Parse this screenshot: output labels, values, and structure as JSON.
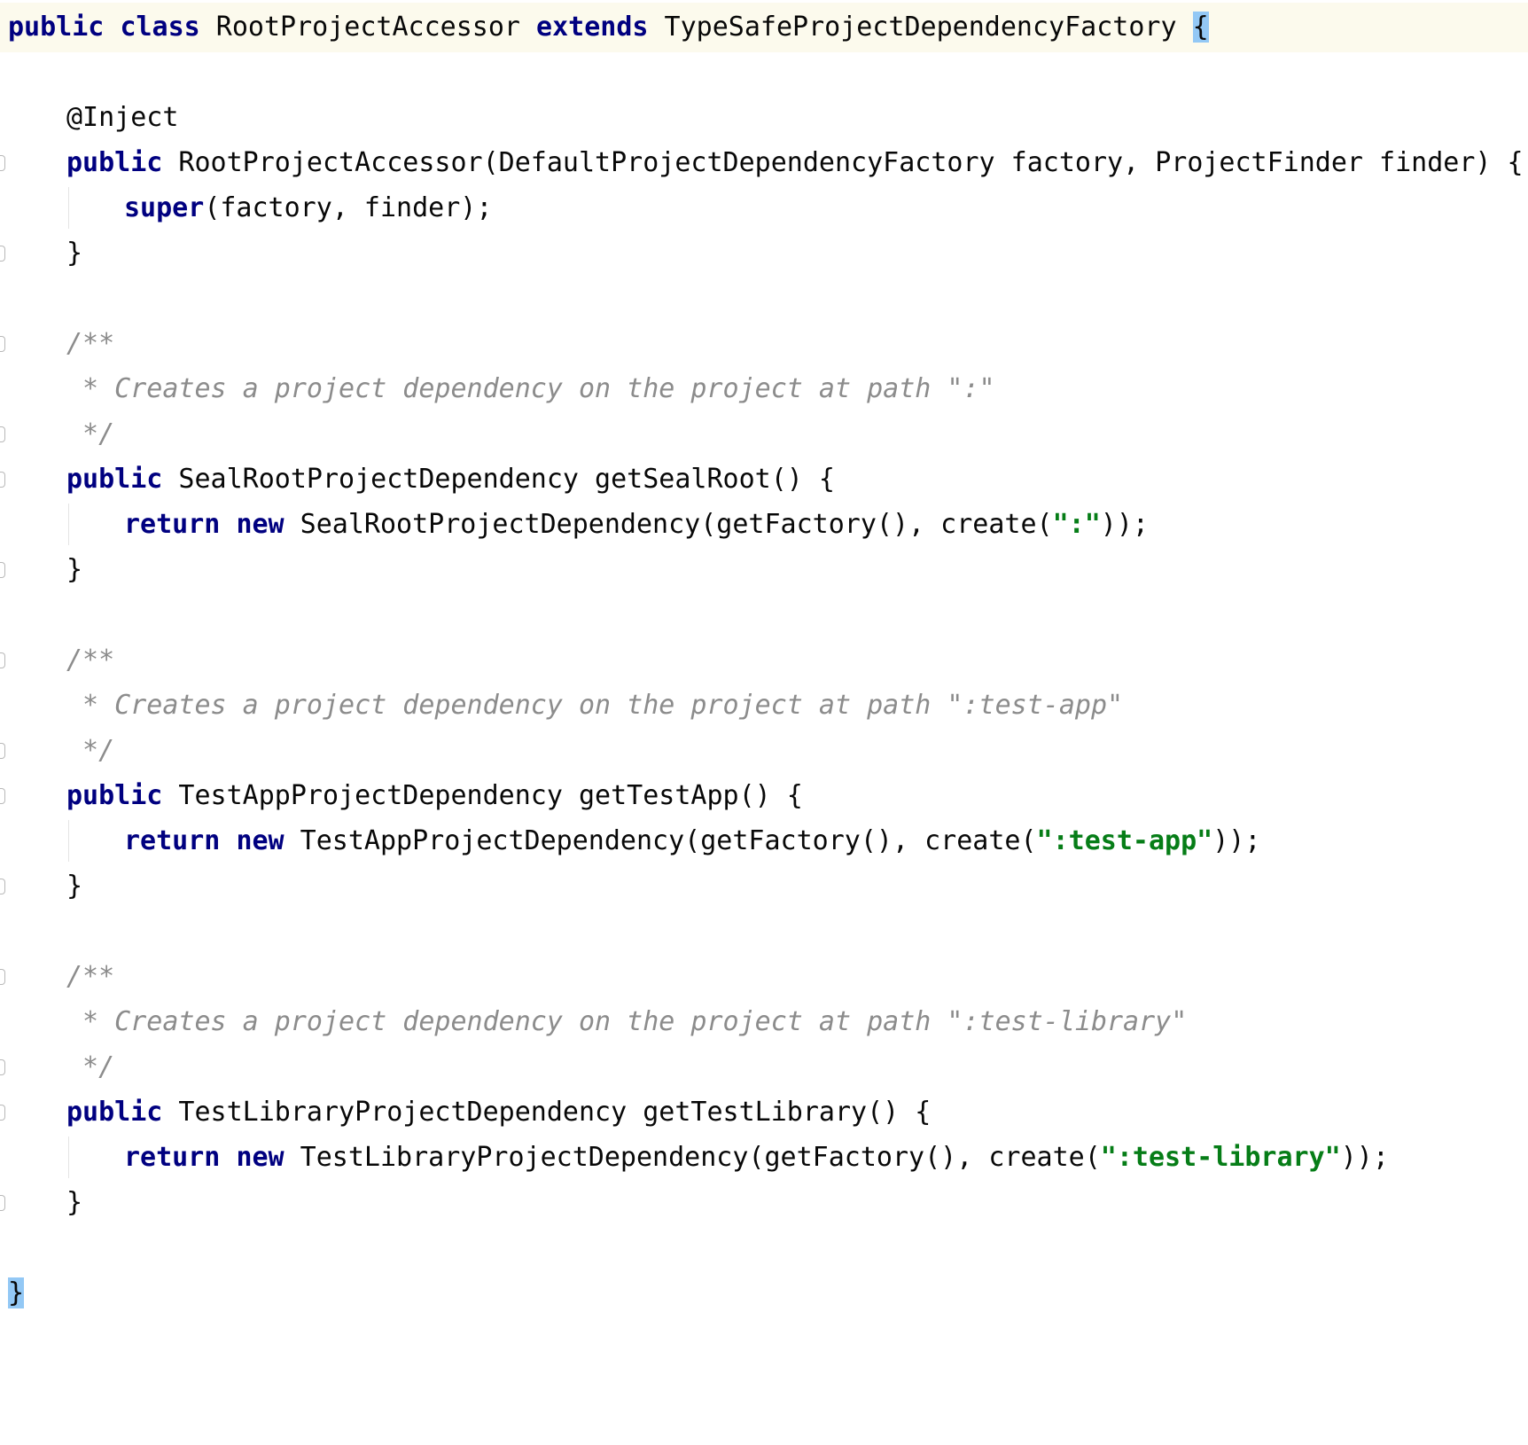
{
  "editor": {
    "lines": [
      {
        "segments": [
          {
            "t": "public",
            "c": "kw-nav"
          },
          {
            "t": " "
          },
          {
            "t": "class",
            "c": "kw-nav"
          },
          {
            "t": " RootProjectAccessor "
          },
          {
            "t": "extends",
            "c": "kw-nav"
          },
          {
            "t": " TypeSafeProjectDependencyFactory "
          },
          {
            "t": "{",
            "c": "brace-match"
          }
        ],
        "current": true,
        "indent": 0
      },
      {
        "segments": [],
        "indent": 0
      },
      {
        "segments": [
          {
            "t": "@Inject",
            "c": "ann"
          }
        ],
        "indent": 1
      },
      {
        "segments": [
          {
            "t": "public",
            "c": "kw-nav"
          },
          {
            "t": " RootProjectAccessor(DefaultProjectDependencyFactory factory, ProjectFinder finder) {"
          }
        ],
        "indent": 1,
        "fold": true
      },
      {
        "segments": [
          {
            "t": "super",
            "c": "kw-nav"
          },
          {
            "t": "(factory, finder);"
          }
        ],
        "indent": 2
      },
      {
        "segments": [
          {
            "t": "}"
          }
        ],
        "indent": 1,
        "fold": true
      },
      {
        "segments": [],
        "indent": 0
      },
      {
        "segments": [
          {
            "t": "/**",
            "c": "doc"
          }
        ],
        "indent": 1,
        "fold": true
      },
      {
        "segments": [
          {
            "t": " * Creates a project dependency on the project at path \":\"",
            "c": "doc"
          }
        ],
        "indent": 1
      },
      {
        "segments": [
          {
            "t": " */",
            "c": "doc"
          }
        ],
        "indent": 1,
        "fold": true
      },
      {
        "segments": [
          {
            "t": "public",
            "c": "kw-nav"
          },
          {
            "t": " SealRootProjectDependency getSealRoot() {"
          }
        ],
        "indent": 1,
        "fold": true
      },
      {
        "segments": [
          {
            "t": "return",
            "c": "kw-nav"
          },
          {
            "t": " "
          },
          {
            "t": "new",
            "c": "kw-nav"
          },
          {
            "t": " SealRootProjectDependency(getFactory(), create("
          },
          {
            "t": "\":\"",
            "c": "str"
          },
          {
            "t": "));"
          }
        ],
        "indent": 2
      },
      {
        "segments": [
          {
            "t": "}"
          }
        ],
        "indent": 1,
        "fold": true
      },
      {
        "segments": [],
        "indent": 0
      },
      {
        "segments": [
          {
            "t": "/**",
            "c": "doc"
          }
        ],
        "indent": 1,
        "fold": true
      },
      {
        "segments": [
          {
            "t": " * Creates a project dependency on the project at path \":test-app\"",
            "c": "doc"
          }
        ],
        "indent": 1
      },
      {
        "segments": [
          {
            "t": " */",
            "c": "doc"
          }
        ],
        "indent": 1,
        "fold": true
      },
      {
        "segments": [
          {
            "t": "public",
            "c": "kw-nav"
          },
          {
            "t": " TestAppProjectDependency getTestApp() {"
          }
        ],
        "indent": 1,
        "fold": true
      },
      {
        "segments": [
          {
            "t": "return",
            "c": "kw-nav"
          },
          {
            "t": " "
          },
          {
            "t": "new",
            "c": "kw-nav"
          },
          {
            "t": " TestAppProjectDependency(getFactory(), create("
          },
          {
            "t": "\":test-app\"",
            "c": "str"
          },
          {
            "t": "));"
          }
        ],
        "indent": 2
      },
      {
        "segments": [
          {
            "t": "}"
          }
        ],
        "indent": 1,
        "fold": true
      },
      {
        "segments": [],
        "indent": 0
      },
      {
        "segments": [
          {
            "t": "/**",
            "c": "doc"
          }
        ],
        "indent": 1,
        "fold": true
      },
      {
        "segments": [
          {
            "t": " * Creates a project dependency on the project at path \":test-library\"",
            "c": "doc"
          }
        ],
        "indent": 1
      },
      {
        "segments": [
          {
            "t": " */",
            "c": "doc"
          }
        ],
        "indent": 1,
        "fold": true
      },
      {
        "segments": [
          {
            "t": "public",
            "c": "kw-nav"
          },
          {
            "t": " TestLibraryProjectDependency getTestLibrary() {"
          }
        ],
        "indent": 1,
        "fold": true
      },
      {
        "segments": [
          {
            "t": "return",
            "c": "kw-nav"
          },
          {
            "t": " "
          },
          {
            "t": "new",
            "c": "kw-nav"
          },
          {
            "t": " TestLibraryProjectDependency(getFactory(), create("
          },
          {
            "t": "\":test-library\"",
            "c": "str"
          },
          {
            "t": "));"
          }
        ],
        "indent": 2
      },
      {
        "segments": [
          {
            "t": "}"
          }
        ],
        "indent": 1,
        "fold": true
      },
      {
        "segments": [],
        "indent": 0
      },
      {
        "segments": [
          {
            "t": "}",
            "c": "brace-match"
          }
        ],
        "indent": 0
      }
    ]
  },
  "colors": {
    "keyword": "#000080",
    "string": "#067d17",
    "doc_comment": "#8c8c8c",
    "current_line": "#fcfaed",
    "brace_match": "#93c8f5"
  }
}
